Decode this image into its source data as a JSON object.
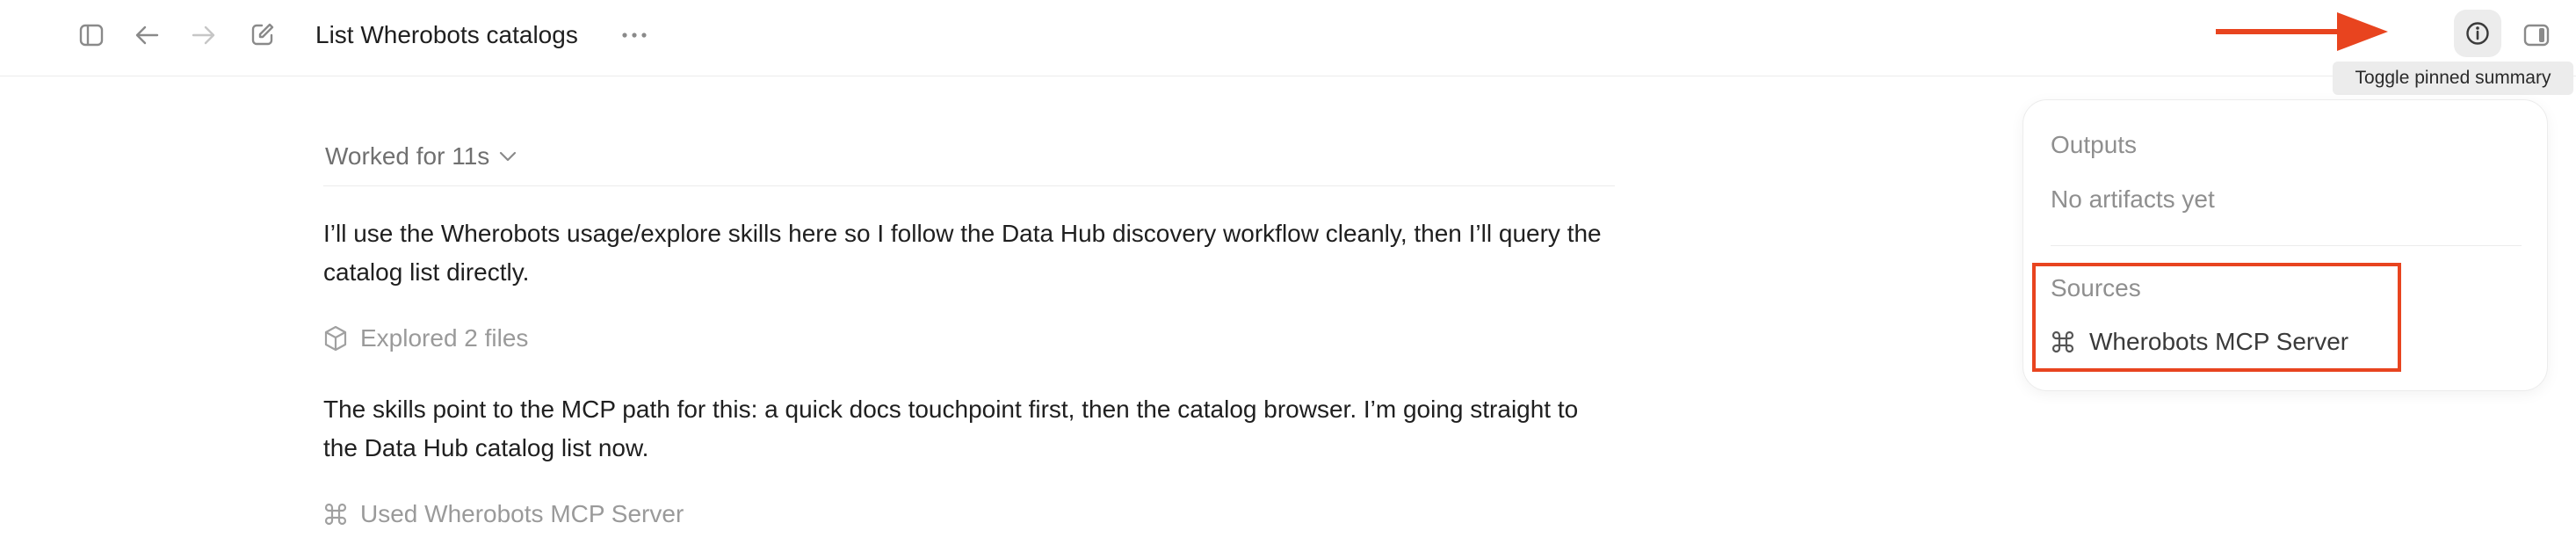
{
  "header": {
    "title": "List Wherobots catalogs",
    "icons": [
      "sidebar-toggle-icon",
      "back-arrow-icon",
      "forward-arrow-icon",
      "compose-icon",
      "more-icon",
      "info-icon",
      "right-panel-icon"
    ],
    "tooltip": "Toggle pinned summary"
  },
  "main": {
    "worked_label": "Worked for 11s",
    "paragraph1": "I’ll use the Wherobots usage/explore skills here so I follow the Data Hub discovery workflow cleanly, then I’ll query the catalog list directly.",
    "tool1": "Explored 2 files",
    "paragraph2": "The skills point to the MCP path for this: a quick docs touchpoint first, then the catalog browser. I’m going straight to the Data Hub catalog list now.",
    "tool2": "Used Wherobots MCP Server"
  },
  "panel": {
    "outputs_label": "Outputs",
    "outputs_empty": "No artifacts yet",
    "sources_label": "Sources",
    "source_item": "Wherobots MCP Server"
  },
  "colors": {
    "annotation": "#e8441f",
    "muted_text": "#8f8f8f",
    "active_bg": "#ececec"
  }
}
